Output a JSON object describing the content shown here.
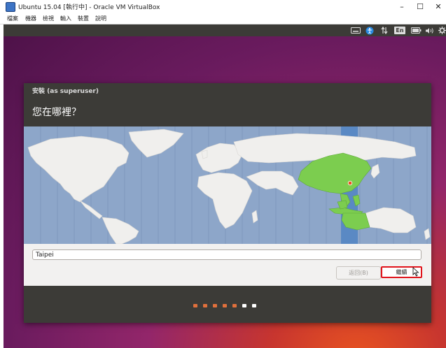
{
  "window": {
    "title": "Ubuntu 15.04 [執行中] - Oracle VM VirtualBox",
    "minimize": "–",
    "maximize": "☐",
    "close": "✕"
  },
  "menu": [
    "檔案",
    "機器",
    "檢視",
    "輸入",
    "裝置",
    "說明"
  ],
  "indicators": {
    "input_method": "En"
  },
  "dialog": {
    "title": "安裝 (as superuser)",
    "heading": "您在哪裡？",
    "timezone_value": "Taipei",
    "back_label": "返回(B)",
    "continue_label": "繼續"
  },
  "progress": {
    "total_steps": 7,
    "completed_steps": 5,
    "colors": {
      "done": "#e0703c",
      "pending": "#ffffff"
    }
  },
  "colors": {
    "ocean": "#8da6c9",
    "land": "#f0efed",
    "highlight_zone": "#7ccd4f",
    "selected_strip": "#5a89c4",
    "topbar": "#3c3b37",
    "continue_border": "#e0131b"
  }
}
